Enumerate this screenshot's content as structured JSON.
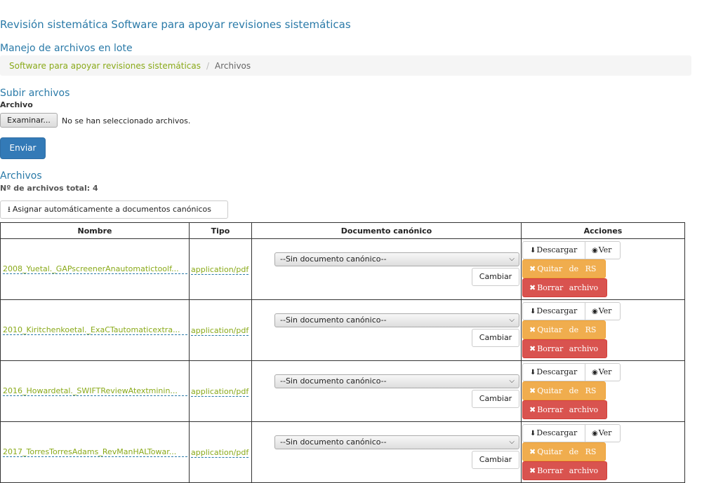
{
  "page": {
    "title": "Revisión sistemática Software para apoyar revisiones sistemáticas",
    "subtitle": "Manejo de archivos en lote"
  },
  "breadcrumb": {
    "link": "Software para apoyar revisiones sistemáticas",
    "current": "Archivos"
  },
  "upload": {
    "heading": "Subir archivos",
    "field_label": "Archivo",
    "browse_label": "Examinar...",
    "no_file_text": "No se han seleccionado archivos.",
    "submit_label": "Enviar"
  },
  "files": {
    "heading": "Archivos",
    "count_text": "Nº de archivos total: 4",
    "assign_label": "Asignar automáticamente a documentos canónicos",
    "columns": [
      "Nombre",
      "Tipo",
      "Documento canónico",
      "Acciones"
    ],
    "select_default": "--Sin documento canónico--",
    "cambiar_label": "Cambiar",
    "actions": {
      "download": "Descargar",
      "view": "Ver",
      "remove": "Quitar de RS",
      "delete": "Borrar archivo"
    },
    "rows": [
      {
        "name": "2008_Yuetal._GAPscreenerAnautomatictoolf...",
        "type": "application/pdf"
      },
      {
        "name": "2010_Kiritchenkoetal._ExaCTautomaticextra...",
        "type": "application/pdf"
      },
      {
        "name": "2016_Howardetal._SWIFTReviewAtextminin...",
        "type": "application/pdf"
      },
      {
        "name": "2017_TorresTorresAdams_RevManHALTowar...",
        "type": "application/pdf"
      }
    ]
  },
  "colors": {
    "heading": "#2a7aa8",
    "link": "#8aaa1a",
    "primary": "#337ab7",
    "warning": "#f0ad4e",
    "danger": "#d9534f"
  }
}
